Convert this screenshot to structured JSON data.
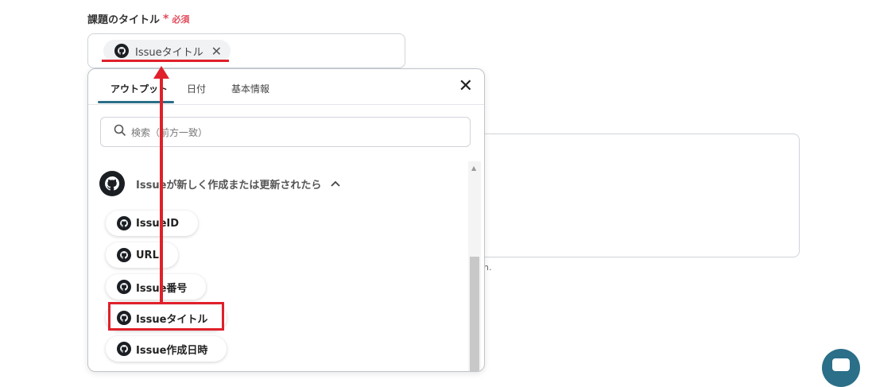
{
  "field": {
    "label": "課題のタイトル",
    "required_star": "*",
    "required_text": "必須",
    "selected_chip": "Issueタイトル",
    "chip_remove": "✕"
  },
  "background": {
    "hint_fragment": "n."
  },
  "panel": {
    "tabs": [
      "アウトプット",
      "日付",
      "基本情報"
    ],
    "close": "✕",
    "search_placeholder": "検索（前方一致）",
    "group_title": "Issueが新しく作成または更新されたら",
    "group_caret": "^",
    "items": [
      "IssueID",
      "URL",
      "Issue番号",
      "Issueタイトル",
      "Issue作成日時"
    ]
  },
  "colors": {
    "accent": "#2b6f88",
    "required": "#e24b5b",
    "annotation_red": "#e0202a"
  },
  "icons": {
    "item_icon": "github-icon",
    "search_icon": "search-icon",
    "close_icon": "close-icon"
  }
}
